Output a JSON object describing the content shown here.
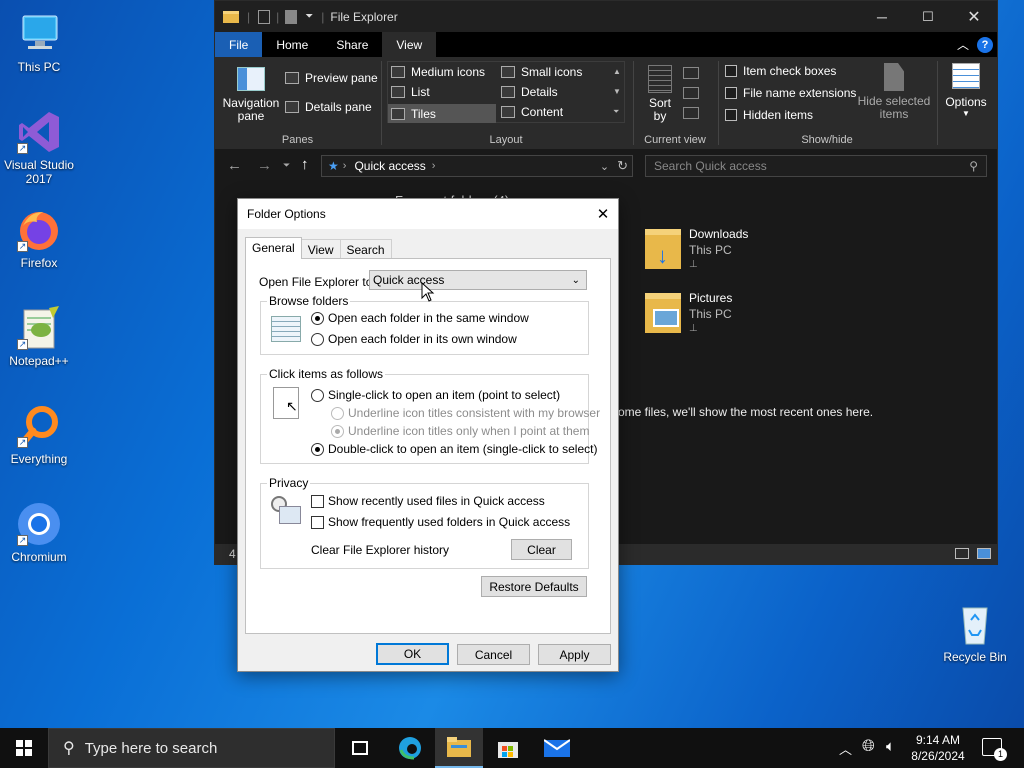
{
  "desktop": {
    "icons": [
      {
        "label": "This PC"
      },
      {
        "label": "Visual Studio 2017"
      },
      {
        "label": "Firefox"
      },
      {
        "label": "Notepad++"
      },
      {
        "label": "Everything"
      },
      {
        "label": "Chromium"
      },
      {
        "label": "Recycle Bin"
      }
    ]
  },
  "explorer": {
    "title": "File Explorer",
    "tabs": [
      "File",
      "Home",
      "Share",
      "View"
    ],
    "active_tab": "View",
    "ribbon": {
      "panes": {
        "navigation_pane": "Navigation pane",
        "preview_pane": "Preview pane",
        "details_pane": "Details pane",
        "group": "Panes"
      },
      "layout": {
        "medium_icons": "Medium icons",
        "small_icons": "Small icons",
        "list": "List",
        "details": "Details",
        "tiles": "Tiles",
        "content": "Content",
        "group": "Layout"
      },
      "current_view": {
        "sort_by": "Sort by",
        "group": "Current view"
      },
      "show_hide": {
        "item_check_boxes": "Item check boxes",
        "file_name_extensions": "File name extensions",
        "hidden_items": "Hidden items",
        "hide_selected": "Hide selected items",
        "group": "Show/hide"
      },
      "options": "Options"
    },
    "address": {
      "location": "Quick access",
      "search_placeholder": "Search Quick access"
    },
    "content": {
      "frequent_header": "Frequent folders (4)",
      "folders": [
        {
          "name": "Downloads",
          "location": "This PC"
        },
        {
          "name": "Pictures",
          "location": "This PC"
        }
      ],
      "recent_message": "ome files, we'll show the most recent ones here.",
      "status_count": "4"
    }
  },
  "dialog": {
    "title": "Folder Options",
    "tabs": [
      "General",
      "View",
      "Search"
    ],
    "open_label": "Open File Explorer to:",
    "open_value": "Quick access",
    "browse": {
      "legend": "Browse folders",
      "same_window": "Open each folder in the same window",
      "own_window": "Open each folder in its own window"
    },
    "click": {
      "legend": "Click items as follows",
      "single": "Single-click to open an item (point to select)",
      "underline_browser": "Underline icon titles consistent with my browser",
      "underline_point": "Underline icon titles only when I point at them",
      "double": "Double-click to open an item (single-click to select)"
    },
    "privacy": {
      "legend": "Privacy",
      "recent_files": "Show recently used files in Quick access",
      "frequent_folders": "Show frequently used folders in Quick access",
      "clear_label": "Clear File Explorer history",
      "clear_button": "Clear"
    },
    "restore_defaults": "Restore Defaults",
    "ok": "OK",
    "cancel": "Cancel",
    "apply": "Apply"
  },
  "taskbar": {
    "search_placeholder": "Type here to search",
    "time": "9:14 AM",
    "date": "8/26/2024",
    "notifications": "1"
  }
}
